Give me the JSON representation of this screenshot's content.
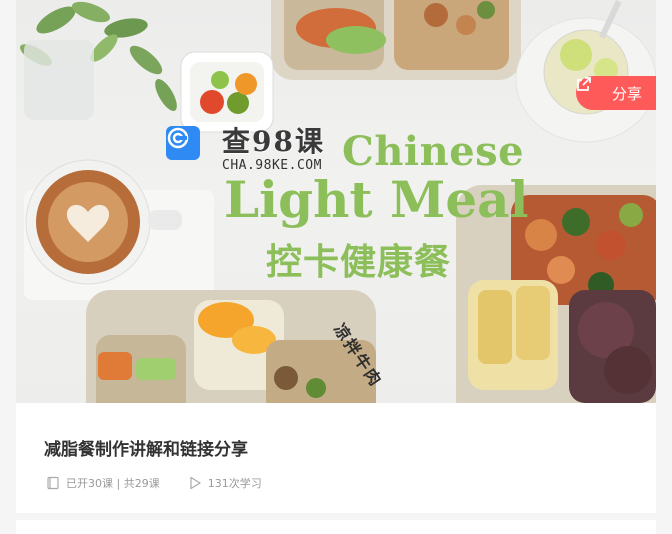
{
  "banner": {
    "watermark_title": "查98课",
    "watermark_subtitle": "CHA.98KE.COM",
    "hero_title_line1": "Chinese",
    "hero_title_line2": "Light Meal",
    "hero_subtitle_cn": "控卡健康餐",
    "dish_label": "凉拌牛肉",
    "share_label": "分享",
    "accent_color": "#ff5a5a",
    "brand_green": "#8cbf5a"
  },
  "course": {
    "title": "减脂餐制作讲解和链接分享",
    "lessons": "已开30课 | 共29课",
    "views": "131次学习",
    "lessons_icon": "book-icon",
    "views_icon": "play-icon"
  }
}
